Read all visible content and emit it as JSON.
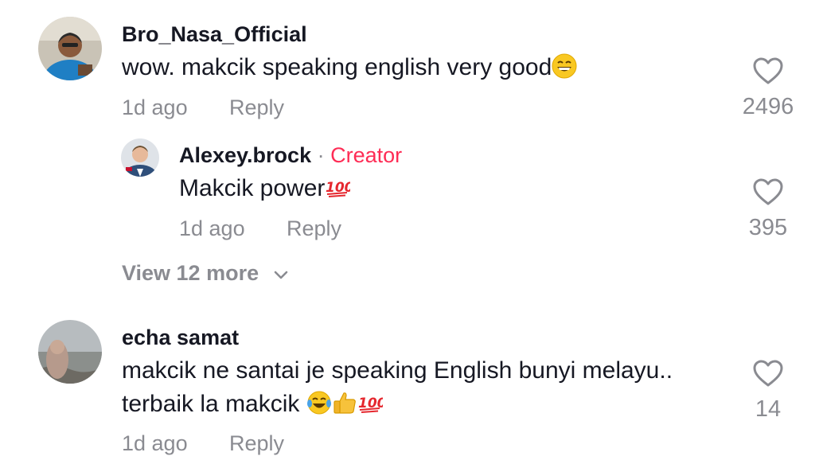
{
  "comments": [
    {
      "username": "Bro_Nasa_Official",
      "text": "wow. makcik speaking english very good",
      "emojis": [
        "grinning-face"
      ],
      "time": "1d ago",
      "reply_label": "Reply",
      "likes": "2496",
      "reply": {
        "username": "Alexey.brock",
        "separator": "·",
        "badge": "Creator",
        "text": "Makcik power",
        "emojis": [
          "hundred-points"
        ],
        "time": "1d ago",
        "reply_label": "Reply",
        "likes": "395"
      },
      "view_more": "View 12 more"
    },
    {
      "username": "echa samat",
      "text_line1": "makcik ne santai je speaking English bunyi melayu..",
      "text_line2": "terbaik la makcik ",
      "emojis": [
        "tears-of-joy",
        "thumbs-up",
        "hundred-points"
      ],
      "time": "1d ago",
      "reply_label": "Reply",
      "likes": "14"
    }
  ],
  "colors": {
    "primary_text": "#161823",
    "secondary_text": "#8a8b91",
    "creator_badge": "#fe2c55"
  }
}
